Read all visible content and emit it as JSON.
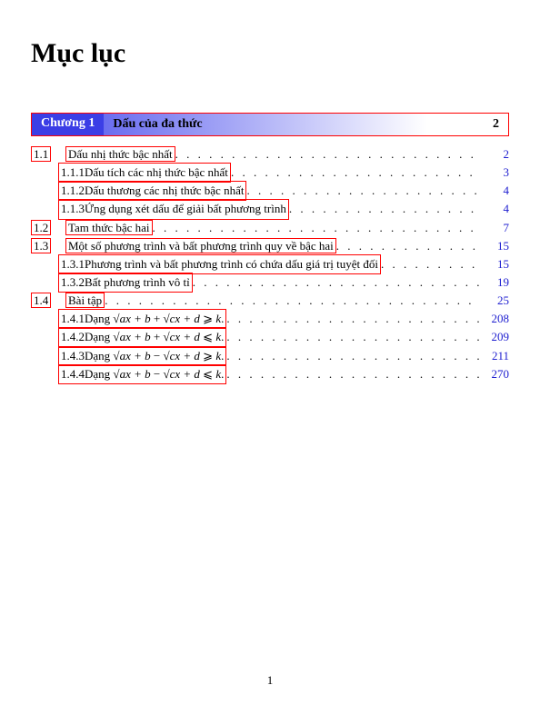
{
  "title": "Mục lục",
  "chapter_label": "Chương 1",
  "chapter_title": "Dấu của đa thức",
  "chapter_page": "2",
  "entries": [
    {
      "type": "section",
      "num": "1.1",
      "text": "Dấu nhị thức bậc nhất",
      "page": "2"
    },
    {
      "type": "subsection",
      "num": "1.1.1",
      "text": "Dấu tích các nhị thức bậc nhất",
      "page": "3"
    },
    {
      "type": "subsection",
      "num": "1.1.2",
      "text": "Dấu thương các nhị thức bậc nhất",
      "page": "4"
    },
    {
      "type": "subsection",
      "num": "1.1.3",
      "text": "Ứng dụng xét dấu để giải bất phương trình",
      "page": "4"
    },
    {
      "type": "section",
      "num": "1.2",
      "text": "Tam thức bậc hai",
      "page": "7"
    },
    {
      "type": "section",
      "num": "1.3",
      "text": "Một số phương trình và bất phương trình quy về bậc hai",
      "page": "15"
    },
    {
      "type": "subsection",
      "num": "1.3.1",
      "text": "Phương trình và bất phương trình có chứa dấu giá trị tuyệt đối",
      "page": "15"
    },
    {
      "type": "subsection",
      "num": "1.3.2",
      "text": "Bất phương trình vô tỉ",
      "page": "19"
    },
    {
      "type": "section",
      "num": "1.4",
      "text": "Bài tập",
      "page": "25"
    },
    {
      "type": "subsection",
      "num": "1.4.1",
      "text_html": "Dạng <span class='sqrt'>√</span><span class='math'>ax + b</span> + <span class='sqrt'>√</span><span class='math'>cx + d</span> ⩾ <span class='math'>k</span>.",
      "page": "208"
    },
    {
      "type": "subsection",
      "num": "1.4.2",
      "text_html": "Dạng <span class='sqrt'>√</span><span class='math'>ax + b</span> + <span class='sqrt'>√</span><span class='math'>cx + d</span> ⩽ <span class='math'>k</span>.",
      "page": "209"
    },
    {
      "type": "subsection",
      "num": "1.4.3",
      "text_html": "Dạng <span class='sqrt'>√</span><span class='math'>ax + b</span> − <span class='sqrt'>√</span><span class='math'>cx + d</span> ⩾ <span class='math'>k</span>.",
      "page": "211"
    },
    {
      "type": "subsection",
      "num": "1.4.4",
      "text_html": "Dạng <span class='sqrt'>√</span><span class='math'>ax + b</span> − <span class='sqrt'>√</span><span class='math'>cx + d</span> ⩽ <span class='math'>k</span>.",
      "page": "270"
    }
  ],
  "footer_page": "1"
}
